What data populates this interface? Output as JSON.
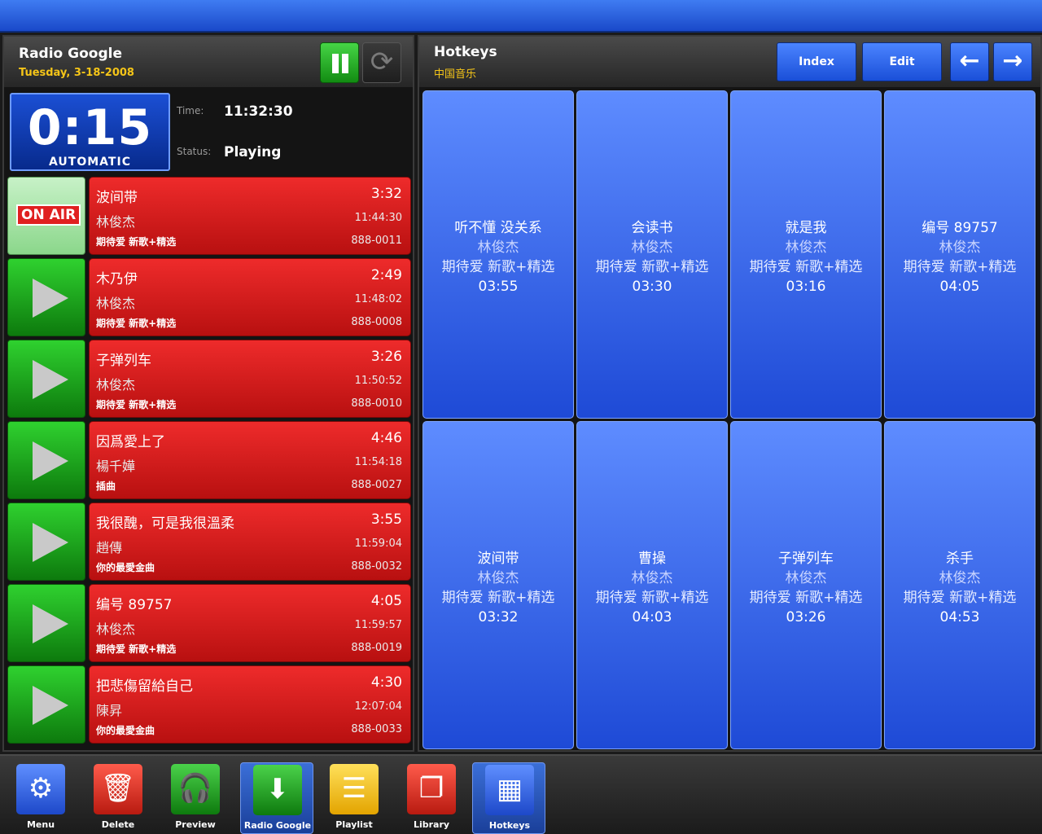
{
  "app": {
    "station_name": "Radio Google",
    "date": "Tuesday, 3-18-2008",
    "counter": "0:15",
    "mode": "AUTOMATIC",
    "time_label": "Time:",
    "time_value": "11:32:30",
    "status_label": "Status:",
    "status_value": "Playing",
    "on_air_label": "ON AIR"
  },
  "tracks": [
    {
      "title": "波间带",
      "duration": "3:32",
      "artist": "林俊杰",
      "start": "11:44:30",
      "album": "期待爱 新歌+精选",
      "code": "888-0011"
    },
    {
      "title": "木乃伊",
      "duration": "2:49",
      "artist": "林俊杰",
      "start": "11:48:02",
      "album": "期待爱 新歌+精选",
      "code": "888-0008"
    },
    {
      "title": "子弹列车",
      "duration": "3:26",
      "artist": "林俊杰",
      "start": "11:50:52",
      "album": "期待爱 新歌+精选",
      "code": "888-0010"
    },
    {
      "title": "因爲愛上了",
      "duration": "4:46",
      "artist": "楊千嬅",
      "start": "11:54:18",
      "album": "插曲",
      "code": "888-0027"
    },
    {
      "title": "我很醜，可是我很溫柔",
      "duration": "3:55",
      "artist": "趙傳",
      "start": "11:59:04",
      "album": "你的最愛金曲",
      "code": "888-0032"
    },
    {
      "title": "编号 89757",
      "duration": "4:05",
      "artist": "林俊杰",
      "start": "11:59:57",
      "album": "期待爱 新歌+精选",
      "code": "888-0019"
    },
    {
      "title": "把悲傷留給自己",
      "duration": "4:30",
      "artist": "陳昇",
      "start": "12:07:04",
      "album": "你的最愛金曲",
      "code": "888-0033"
    }
  ],
  "hotkeys_panel": {
    "title": "Hotkeys",
    "subtitle": "中国音乐",
    "index_label": "Index",
    "edit_label": "Edit",
    "back_arrow": "←",
    "forward_arrow": "→"
  },
  "hotkeys": [
    {
      "song": "听不懂 没关系",
      "artist": "林俊杰",
      "album": "期待爱 新歌+精选",
      "duration": "03:55"
    },
    {
      "song": "会读书",
      "artist": "林俊杰",
      "album": "期待爱 新歌+精选",
      "duration": "03:30"
    },
    {
      "song": "就是我",
      "artist": "林俊杰",
      "album": "期待爱 新歌+精选",
      "duration": "03:16"
    },
    {
      "song": "编号 89757",
      "artist": "林俊杰",
      "album": "期待爱 新歌+精选",
      "duration": "04:05"
    },
    {
      "song": "波间带",
      "artist": "林俊杰",
      "album": "期待爱 新歌+精选",
      "duration": "03:32"
    },
    {
      "song": "曹操",
      "artist": "林俊杰",
      "album": "期待爱 新歌+精选",
      "duration": "04:03"
    },
    {
      "song": "子弹列车",
      "artist": "林俊杰",
      "album": "期待爱 新歌+精选",
      "duration": "03:26"
    },
    {
      "song": "杀手",
      "artist": "林俊杰",
      "album": "期待爱 新歌+精选",
      "duration": "04:53"
    }
  ],
  "toolbar": [
    {
      "label": "Menu",
      "icon": "gear-icon",
      "glyph": "⚙"
    },
    {
      "label": "Delete",
      "icon": "trash-icon",
      "glyph": "🗑"
    },
    {
      "label": "Preview",
      "icon": "headphones-icon",
      "glyph": "🎧"
    },
    {
      "label": "Radio Google",
      "icon": "station-icon",
      "glyph": "⬇"
    },
    {
      "label": "Playlist",
      "icon": "playlist-icon",
      "glyph": "☰"
    },
    {
      "label": "Library",
      "icon": "library-icon",
      "glyph": "❐"
    },
    {
      "label": "Hotkeys",
      "icon": "hotkeys-icon",
      "glyph": "▦"
    }
  ],
  "colors": {
    "accent_blue": "#1a4fd8",
    "track_red": "#d81e1e",
    "play_green": "#1faa1f",
    "date_yellow": "#f5c518"
  }
}
